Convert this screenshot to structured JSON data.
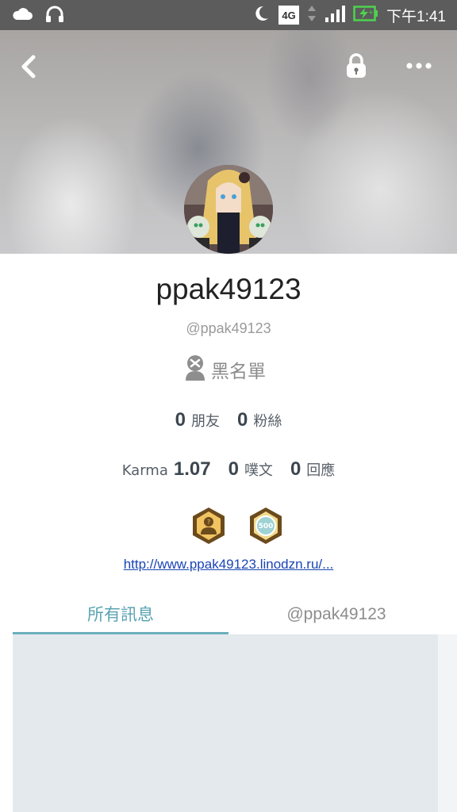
{
  "status_bar": {
    "left_icons": [
      "cloud-icon",
      "headphone-icon"
    ],
    "right_icons": [
      "moon-icon",
      "4g-icon",
      "signal-icon",
      "battery-charging-icon"
    ],
    "network": "4G",
    "time": "下午1:41"
  },
  "header": {
    "back_icon": "chevron-left-icon",
    "lock_icon": "lock-icon",
    "more_icon": "more-horizontal-icon"
  },
  "profile": {
    "display_name": "ppak49123",
    "handle": "@ppak49123",
    "blacklist_label": "黑名單",
    "stats_row1": [
      {
        "num": "0",
        "label": "朋友"
      },
      {
        "num": "0",
        "label": "粉絲"
      }
    ],
    "karma_label": "Karma",
    "karma_value": "1.07",
    "stats_row2": [
      {
        "num": "0",
        "label": "噗文"
      },
      {
        "num": "0",
        "label": "回應"
      }
    ],
    "badge_2_text": "500",
    "website": "http://www.ppak49123.linodzn.ru/..."
  },
  "tabs": [
    {
      "label": "所有訊息",
      "active": true
    },
    {
      "label": "@ppak49123",
      "active": false
    }
  ],
  "colors": {
    "accent": "#6cb0bd",
    "link": "#1a45b5",
    "feed_bg": "#e3e9ec"
  }
}
